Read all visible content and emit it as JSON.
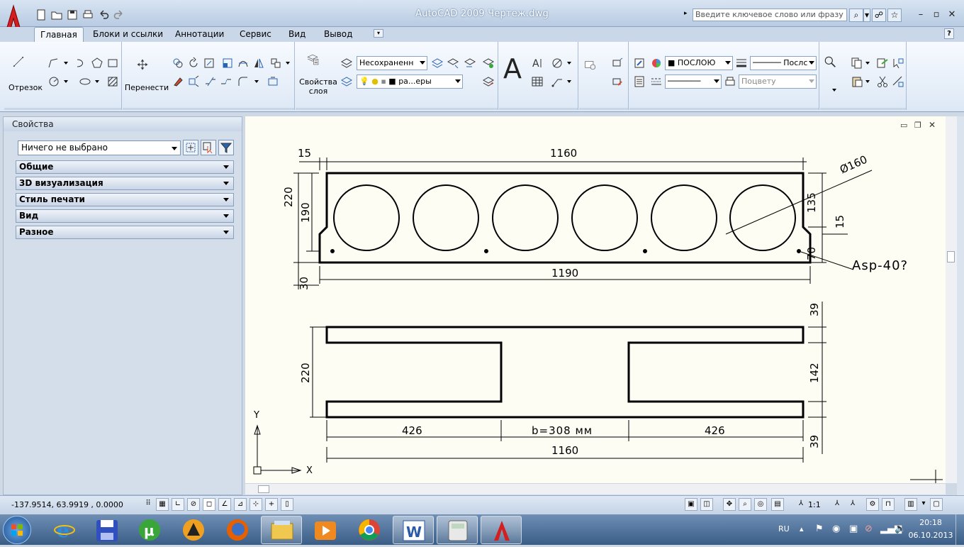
{
  "window": {
    "title_app": "AutoCAD 2009",
    "title_file": "Чертеж.dwg",
    "search_placeholder": "Введите ключевое слово или фразу"
  },
  "tabs": [
    "Главная",
    "Блоки и ссылки",
    "Аннотации",
    "Сервис",
    "Вид",
    "Вывод"
  ],
  "ribbon": {
    "draw_big": "Отрезок",
    "modify_big": "Перенести",
    "layer_big_line1": "Свойства",
    "layer_big_line2": "слоя",
    "layer_state_combo": "Несохраненн",
    "layer_combo": "ра...еры",
    "color_combo": "ПОСЛОЮ",
    "linetype_combo": "Послс",
    "plotstyle_combo": "Поцвету"
  },
  "properties": {
    "title": "Свойства",
    "selection": "Ничего не выбрано",
    "sections": [
      "Общие",
      "3D визуализация",
      "Стиль печати",
      "Вид",
      "Разное"
    ]
  },
  "drawing": {
    "top": {
      "dim_15_top": "15",
      "dim_1160_top": "1160",
      "dim_phi": "Ø160",
      "dim_220": "220",
      "dim_190": "190",
      "dim_135": "135",
      "dim_15_right": "15",
      "dim_70": "70",
      "dim_30": "30",
      "dim_1190": "1190",
      "rebar_label": "Asp-40?"
    },
    "bottom": {
      "dim_39_top": "39",
      "dim_142": "142",
      "dim_39_bottom": "39",
      "dim_220": "220",
      "dim_426_left": "426",
      "dim_b": "b=308 мм",
      "dim_426_right": "426",
      "dim_1160": "1160"
    },
    "ucs_y": "Y",
    "ucs_x": "X"
  },
  "status": {
    "coordinates": "-137.9514, 63.9919 , 0.0000",
    "annotation_scale": "1:1"
  },
  "taskbar": {
    "lang": "RU",
    "time": "20:18",
    "date": "06.10.2013"
  }
}
